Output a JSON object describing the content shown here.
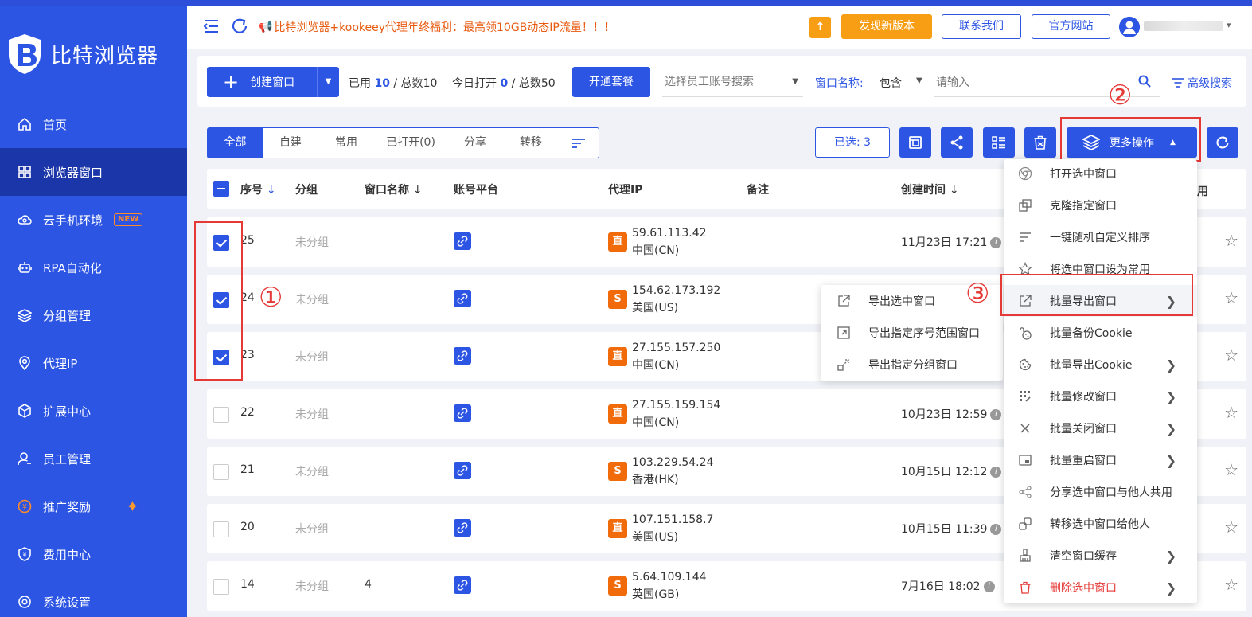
{
  "app": {
    "name": "比特浏览器"
  },
  "sidebar": {
    "items": [
      {
        "label": "首页",
        "icon": "home-icon"
      },
      {
        "label": "浏览器窗口",
        "icon": "grid-icon",
        "active": true
      },
      {
        "label": "云手机环境",
        "icon": "cloud-icon",
        "badge": "NEW"
      },
      {
        "label": "RPA自动化",
        "icon": "robot-icon"
      },
      {
        "label": "分组管理",
        "icon": "layers-icon"
      },
      {
        "label": "代理IP",
        "icon": "location-icon"
      },
      {
        "label": "扩展中心",
        "icon": "cube-icon"
      },
      {
        "label": "员工管理",
        "icon": "user-icon"
      },
      {
        "label": "推广奖励",
        "icon": "yuan-coin-icon"
      },
      {
        "label": "费用中心",
        "icon": "yuan-shield-icon"
      },
      {
        "label": "系统设置",
        "icon": "settings-icon"
      }
    ]
  },
  "topbar": {
    "promo": "比特浏览器+kookeey代理年终福利：最高领10GB动态IP流量！！！",
    "new_version": "发现新版本",
    "contact": "联系我们",
    "official_site": "官方网站"
  },
  "toolbar": {
    "create_label": "创建窗口",
    "used_prefix": "已用",
    "used": "10",
    "total_prefix": "/ 总数",
    "total": "10",
    "opened_prefix": "今日打开",
    "opened": "0",
    "opened_total_prefix": "/ 总数",
    "opened_total": "50",
    "plan_label": "开通套餐",
    "staff_placeholder": "选择员工账号搜索",
    "window_name_label": "窗口名称:",
    "match_mode": "包含",
    "name_placeholder": "请输入",
    "advanced_search": "高级搜索"
  },
  "tabs": [
    "全部",
    "自建",
    "常用",
    "已打开(0)",
    "分享",
    "转移"
  ],
  "selected_label": "已选: 3",
  "more_ops_label": "更多操作",
  "table": {
    "headers": {
      "seq": "序号",
      "group": "分组",
      "name": "窗口名称",
      "platform": "账号平台",
      "proxy": "代理IP",
      "note": "备注",
      "created": "创建时间",
      "last": "用"
    },
    "rows": [
      {
        "seq": "25",
        "group": "未分组",
        "name": "",
        "proxy_type": "直",
        "ip": "59.61.113.42",
        "region": "中国(CN)",
        "created": "11月23日 17:21",
        "checked": true
      },
      {
        "seq": "24",
        "group": "未分组",
        "name": "",
        "proxy_type": "S",
        "ip": "154.62.173.192",
        "region": "美国(US)",
        "created": "",
        "checked": true
      },
      {
        "seq": "23",
        "group": "未分组",
        "name": "",
        "proxy_type": "直",
        "ip": "27.155.157.250",
        "region": "中国(CN)",
        "created": "",
        "checked": true
      },
      {
        "seq": "22",
        "group": "未分组",
        "name": "",
        "proxy_type": "直",
        "ip": "27.155.159.154",
        "region": "中国(CN)",
        "created": "10月23日 12:59",
        "checked": false
      },
      {
        "seq": "21",
        "group": "未分组",
        "name": "",
        "proxy_type": "S",
        "ip": "103.229.54.24",
        "region": "香港(HK)",
        "created": "10月15日 12:12",
        "checked": false
      },
      {
        "seq": "20",
        "group": "未分组",
        "name": "",
        "proxy_type": "直",
        "ip": "107.151.158.7",
        "region": "美国(US)",
        "created": "10月15日 11:39",
        "checked": false
      },
      {
        "seq": "14",
        "group": "未分组",
        "name": "4",
        "proxy_type": "S",
        "ip": "5.64.109.144",
        "region": "英国(GB)",
        "created": "7月16日 18:02",
        "checked": false
      }
    ]
  },
  "more_menu": [
    {
      "label": "打开选中窗口",
      "icon": "chrome-icon"
    },
    {
      "label": "克隆指定窗口",
      "icon": "clone-icon"
    },
    {
      "label": "一键随机自定义排序",
      "icon": "sort-icon"
    },
    {
      "label": "将选中窗口设为常用",
      "icon": "star-icon"
    },
    {
      "label": "批量导出窗口",
      "icon": "export-icon",
      "submenu": true
    },
    {
      "label": "批量备份Cookie",
      "icon": "backup-cookie-icon"
    },
    {
      "label": "批量导出Cookie",
      "icon": "cookie-icon",
      "submenu": true
    },
    {
      "label": "批量修改窗口",
      "icon": "edit-grid-icon",
      "submenu": true
    },
    {
      "label": "批量关闭窗口",
      "icon": "close-icon",
      "submenu": true
    },
    {
      "label": "批量重启窗口",
      "icon": "restart-icon",
      "submenu": true
    },
    {
      "label": "分享选中窗口与他人共用",
      "icon": "share-icon"
    },
    {
      "label": "转移选中窗口给他人",
      "icon": "transfer-icon"
    },
    {
      "label": "清空窗口缓存",
      "icon": "broom-icon",
      "submenu": true
    },
    {
      "label": "删除选中窗口",
      "icon": "trash-icon",
      "submenu": true,
      "danger": true
    }
  ],
  "export_submenu": [
    "导出选中窗口",
    "导出指定序号范围窗口",
    "导出指定分组窗口"
  ],
  "annotations": [
    "①",
    "②",
    "③"
  ],
  "colors": {
    "primary": "#2d55e3",
    "orange": "#f89e15",
    "danger": "#e53935"
  }
}
